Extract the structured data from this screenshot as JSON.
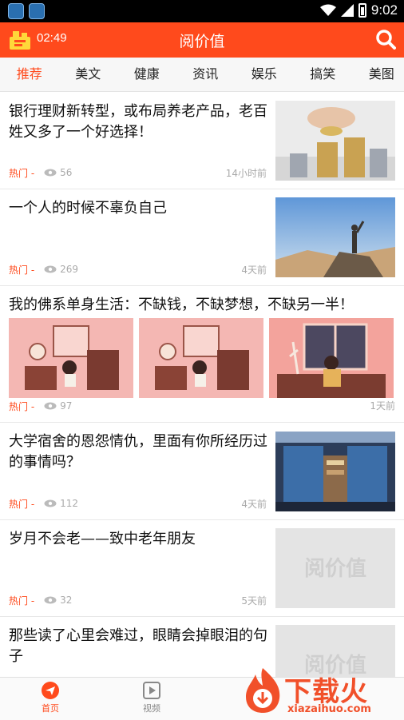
{
  "status_bar": {
    "time": "9:02"
  },
  "header": {
    "clock": "02:49",
    "title": "阅价值"
  },
  "tabs": [
    "推荐",
    "美文",
    "健康",
    "资讯",
    "娱乐",
    "搞笑",
    "美图"
  ],
  "articles": [
    {
      "title": "银行理财新转型，或布局养老产品，老百姓又多了一个好选择！",
      "tag": "热门 -",
      "views": "56",
      "time": "14小时前"
    },
    {
      "title": "一个人的时候不辜负自己",
      "tag": "热门 -",
      "views": "269",
      "time": "4天前"
    },
    {
      "title": "我的佛系单身生活：不缺钱，不缺梦想，不缺另一半！",
      "tag": "热门 -",
      "views": "97",
      "time": "1天前"
    },
    {
      "title": "大学宿舍的恩怨情仇，里面有你所经历过的事情吗？",
      "tag": "热门 -",
      "views": "112",
      "time": "4天前"
    },
    {
      "title": "岁月不会老——致中老年朋友",
      "tag": "热门 -",
      "views": "32",
      "time": "5天前",
      "placeholder": "阅价值"
    },
    {
      "title": "那些读了心里会难过，眼睛会掉眼泪的句子",
      "placeholder": "阅价值"
    }
  ],
  "bottom_nav": [
    "首页",
    "视频"
  ],
  "watermark": {
    "text": "下载火",
    "url": "xiazaihuo.com"
  },
  "colors": {
    "accent": "#ff4a1c"
  }
}
